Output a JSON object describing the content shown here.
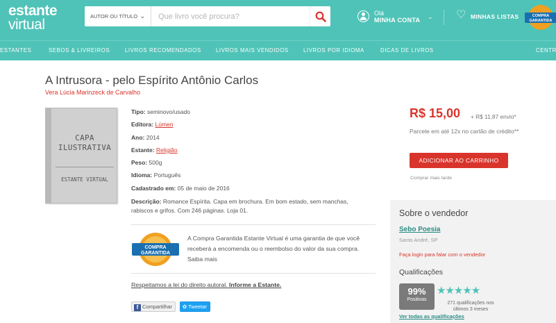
{
  "header": {
    "logo_line1": "estante",
    "logo_line2": "virtual",
    "search_scope": "AUTOR OU TÍTULO",
    "search_placeholder": "Que livro você procura?",
    "account_greeting": "Olá",
    "account_label": "MINHA CONTA",
    "lists_label": "MINHAS LISTAS",
    "badge_text": "COMPRA GARANTIDA"
  },
  "nav": {
    "items": [
      "ESTANTES",
      "SEBOS & LIVREIROS",
      "LIVROS RECOMENDADOS",
      "LIVROS MAIS VENDIDOS",
      "LIVROS POR IDIOMA",
      "DICAS DE LIVROS",
      "CENTR"
    ]
  },
  "book": {
    "title": "A Intrusora - pelo Espírito Antônio Carlos",
    "author": "Vera Lúcia Marinzeck de Carvalho",
    "cover_text_line1": "CAPA",
    "cover_text_line2": "ILUSTRATIVA",
    "cover_bottom": "ESTANTE VIRTUAL",
    "details": {
      "tipo_label": "Tipo:",
      "tipo": "seminovo/usado",
      "editora_label": "Editora:",
      "editora": "Lúmen",
      "ano_label": "Ano:",
      "ano": "2014",
      "estante_label": "Estante:",
      "estante": "Religião",
      "peso_label": "Peso:",
      "peso": "500g",
      "idioma_label": "Idioma:",
      "idioma": "Português",
      "cadastrado_label": "Cadastrado em:",
      "cadastrado": "05 de maio de 2016",
      "descricao_label": "Descrição:",
      "descricao": "Romance Espírita. Capa em brochura. Em bom estado, sem manchas, rabiscos e grifos. Com 246 páginas. Loja 01."
    },
    "guarantee_badge": "COMPRA GARANTIDA",
    "guarantee_text": "A Compra Garantida Estante Virtual é uma garantia de que você receberá a encomenda ou o reembolso do valor da sua compra. Saiba mais",
    "law_text": "Respeitamos a lei do direito autoral.",
    "law_link": "Informe a Estante.",
    "share_fb": "Compartilhar",
    "share_tw": "Tweetar"
  },
  "purchase": {
    "price": "R$ 15,00",
    "shipping": "+ R$ 11,87 envio*",
    "installments": "Parcele em até 12x no cartão de crédito**",
    "cart_button": "ADICIONAR AO CARRINHO",
    "buy_later": "Comprar mais tarde"
  },
  "seller": {
    "heading": "Sobre o vendedor",
    "name": "Sebo Poesia",
    "location": "Santo André, SP",
    "login_prompt": "Faça login para falar com o vendedor",
    "ratings_heading": "Qualificações",
    "percent": "99%",
    "percent_label": "Positivas",
    "stars": "★★★★★",
    "rating_count": "271 qualificações nos últimos 3 meses",
    "see_all": "Ver todas as qualificações"
  },
  "colors": {
    "brand": "#4fc3b7",
    "accent": "#d9342b",
    "seller_link": "#2a8c84"
  }
}
